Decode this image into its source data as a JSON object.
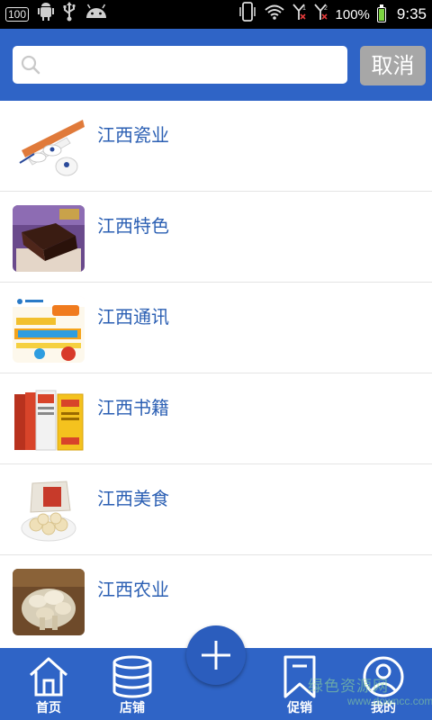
{
  "status_bar": {
    "badge": "100",
    "battery_text": "100%",
    "time": "9:35",
    "icons": [
      "badge-100-icon",
      "android-debug-icon",
      "usb-icon",
      "android-icon",
      "vibrate-icon",
      "wifi-icon",
      "signal-1-icon",
      "signal-2-icon",
      "battery-icon"
    ]
  },
  "search": {
    "placeholder": "",
    "value": "",
    "cancel_label": "取消"
  },
  "list": {
    "items": [
      {
        "label": "江西瓷业",
        "thumb": "ceramics"
      },
      {
        "label": "江西特色",
        "thumb": "specialty"
      },
      {
        "label": "江西通讯",
        "thumb": "telecom"
      },
      {
        "label": "江西书籍",
        "thumb": "books"
      },
      {
        "label": "江西美食",
        "thumb": "food"
      },
      {
        "label": "江西农业",
        "thumb": "agriculture"
      }
    ]
  },
  "bottom_nav": {
    "items": [
      {
        "label": "首页",
        "icon": "home-icon"
      },
      {
        "label": "店铺",
        "icon": "database-icon"
      },
      {
        "label": "促销",
        "icon": "bookmark-icon"
      },
      {
        "label": "我的",
        "icon": "user-icon"
      }
    ],
    "fab_icon": "plus-icon"
  },
  "watermark": {
    "text_cn": "绿色资源网",
    "text_en": "www.downcc.com"
  },
  "colors": {
    "header_blue": "#2f64c6",
    "label_blue": "#2b5fb3",
    "cancel_gray": "#a7a7a7"
  }
}
